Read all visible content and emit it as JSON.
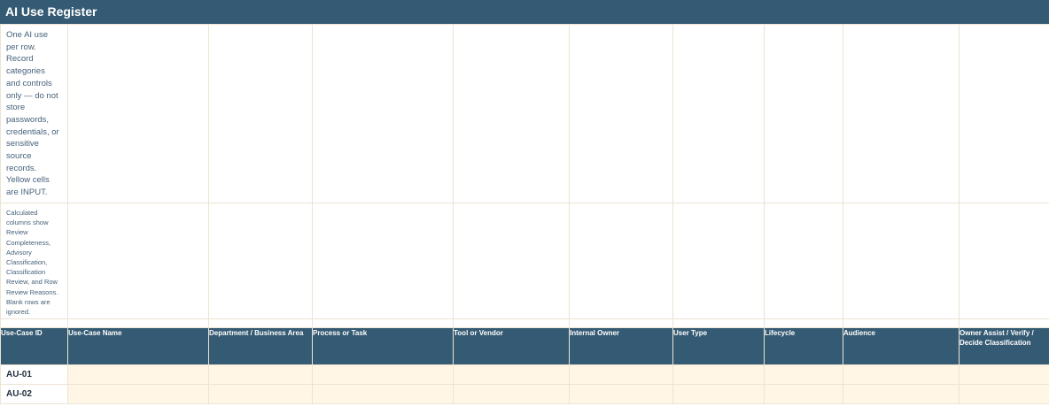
{
  "sheet": {
    "title": "AI Use Register",
    "note_primary": "One AI use per row. Record categories and controls only — do not store passwords, credentials, or sensitive source records. Yellow cells are INPUT.",
    "note_secondary": "Calculated columns show Review Completeness, Advisory Classification, Classification Review, and Row Review Reasons. Blank rows are ignored.",
    "columns": [
      "Use-Case ID",
      "Use-Case Name",
      "Department / Business Area",
      "Process or Task",
      "Tool or Vendor",
      "Internal Owner",
      "User Type",
      "Lifecycle",
      "Audience",
      "Owner Assist / Verify / Decide Classification"
    ],
    "rows": [
      {
        "id": "AU-01"
      },
      {
        "id": "AU-02"
      }
    ],
    "colors": {
      "header_bg": "#355a73",
      "header_text": "#ffffff",
      "input_cell": "#fff6e6",
      "gridline": "#ece4d3"
    }
  }
}
